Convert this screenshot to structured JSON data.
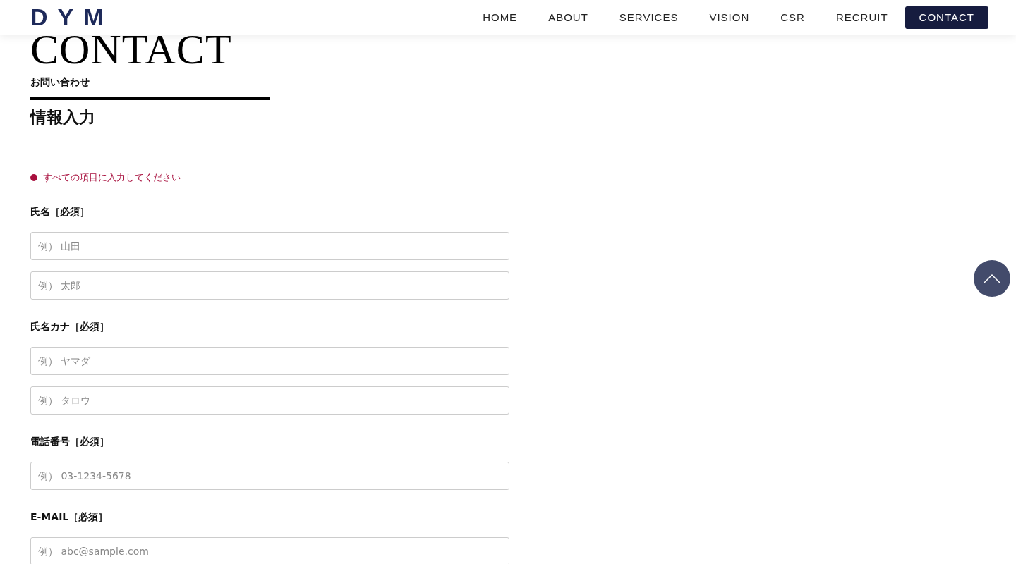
{
  "header": {
    "logo": "DYM",
    "nav": [
      {
        "label": "HOME",
        "selected": false
      },
      {
        "label": "ABOUT",
        "selected": false
      },
      {
        "label": "SERVICES",
        "selected": false
      },
      {
        "label": "VISION",
        "selected": false
      },
      {
        "label": "CSR",
        "selected": false
      },
      {
        "label": "RECRUIT",
        "selected": false
      },
      {
        "label": "CONTACT",
        "selected": true
      }
    ]
  },
  "page_title": "CONTACT",
  "page_subtitle": "お問い合わせ",
  "section_title": "情報入力",
  "notice": "すべての項目に入力してください",
  "form": [
    {
      "label": "氏名［必須］",
      "fields": [
        {
          "placeholder": "例） 山田"
        },
        {
          "placeholder": "例） 太郎"
        }
      ]
    },
    {
      "label": "氏名カナ［必須］",
      "fields": [
        {
          "placeholder": "例） ヤマダ"
        },
        {
          "placeholder": "例） タロウ"
        }
      ]
    },
    {
      "label": "電話番号［必須］",
      "fields": [
        {
          "placeholder": "例） 03-1234-5678"
        }
      ]
    },
    {
      "label": "E-MAIL［必須］",
      "fields": [
        {
          "placeholder": "例） abc@sample.com"
        }
      ]
    }
  ]
}
